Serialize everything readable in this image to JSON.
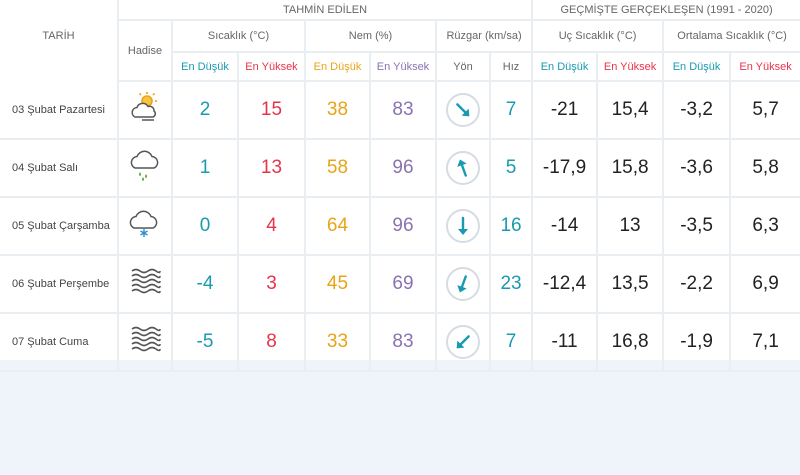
{
  "header": {
    "group_forecast": "TAHMİN EDİLEN",
    "group_history": "GEÇMİŞTE GERÇEKLEŞEN (1991 - 2020)",
    "col_date": "TARİH",
    "col_event": "Hadise",
    "col_temp": "Sıcaklık (°C)",
    "col_humidity": "Nem (%)",
    "col_wind": "Rüzgar (km/sa)",
    "col_extreme": "Uç Sıcaklık (°C)",
    "col_avg": "Ortalama Sıcaklık (°C)",
    "sub_low": "En Düşük",
    "sub_high": "En Yüksek",
    "sub_dir": "Yön",
    "sub_speed": "Hız"
  },
  "days": [
    {
      "date": "03 Şubat Pazartesi",
      "icon": "partly-cloudy-sun-icon",
      "temp_low": "2",
      "temp_high": "15",
      "hum_low": "38",
      "hum_high": "83",
      "wind_dir_deg": 135,
      "wind_speed": "7",
      "ext_low": "-21",
      "ext_high": "15,4",
      "avg_low": "-3,2",
      "avg_high": "5,7"
    },
    {
      "date": "04 Şubat Salı",
      "icon": "rain-cloud-icon",
      "temp_low": "1",
      "temp_high": "13",
      "hum_low": "58",
      "hum_high": "96",
      "wind_dir_deg": 340,
      "wind_speed": "5",
      "ext_low": "-17,9",
      "ext_high": "15,8",
      "avg_low": "-3,6",
      "avg_high": "5,8"
    },
    {
      "date": "05 Şubat Çarşamba",
      "icon": "snow-cloud-icon",
      "temp_low": "0",
      "temp_high": "4",
      "hum_low": "64",
      "hum_high": "96",
      "wind_dir_deg": 180,
      "wind_speed": "16",
      "ext_low": "-14",
      "ext_high": "13",
      "avg_low": "-3,5",
      "avg_high": "6,3"
    },
    {
      "date": "06 Şubat Perşembe",
      "icon": "fog-icon",
      "temp_low": "-4",
      "temp_high": "3",
      "hum_low": "45",
      "hum_high": "69",
      "wind_dir_deg": 200,
      "wind_speed": "23",
      "ext_low": "-12,4",
      "ext_high": "13,5",
      "avg_low": "-2,2",
      "avg_high": "6,9"
    },
    {
      "date": "07 Şubat Cuma",
      "icon": "fog-icon",
      "temp_low": "-5",
      "temp_high": "8",
      "hum_low": "33",
      "hum_high": "83",
      "wind_dir_deg": 225,
      "wind_speed": "7",
      "ext_low": "-11",
      "ext_high": "16,8",
      "avg_low": "-1,9",
      "avg_high": "7,1"
    }
  ],
  "colors": {
    "temp_low": "#1a9ab0",
    "temp_high": "#e8334a",
    "hum_low": "#e8a417",
    "hum_high": "#8a72b0",
    "arrow": "#1a9ab0"
  }
}
